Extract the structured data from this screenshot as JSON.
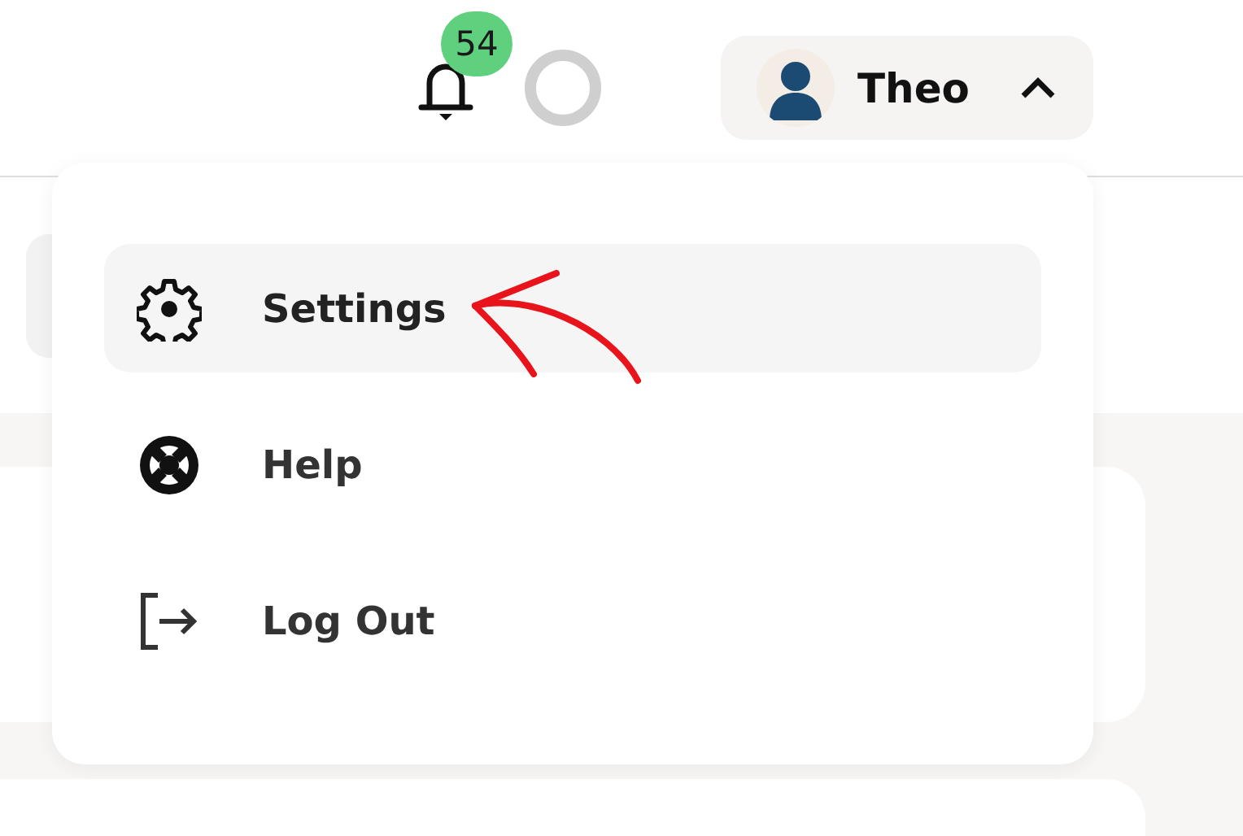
{
  "header": {
    "notifications": {
      "count": "54"
    },
    "user": {
      "name": "Theo",
      "menu_open": true
    }
  },
  "user_menu": {
    "items": [
      {
        "kind": "settings",
        "label": "Settings",
        "selected": true
      },
      {
        "kind": "help",
        "label": "Help",
        "selected": false
      },
      {
        "kind": "logout",
        "label": "Log Out",
        "selected": false
      }
    ]
  }
}
